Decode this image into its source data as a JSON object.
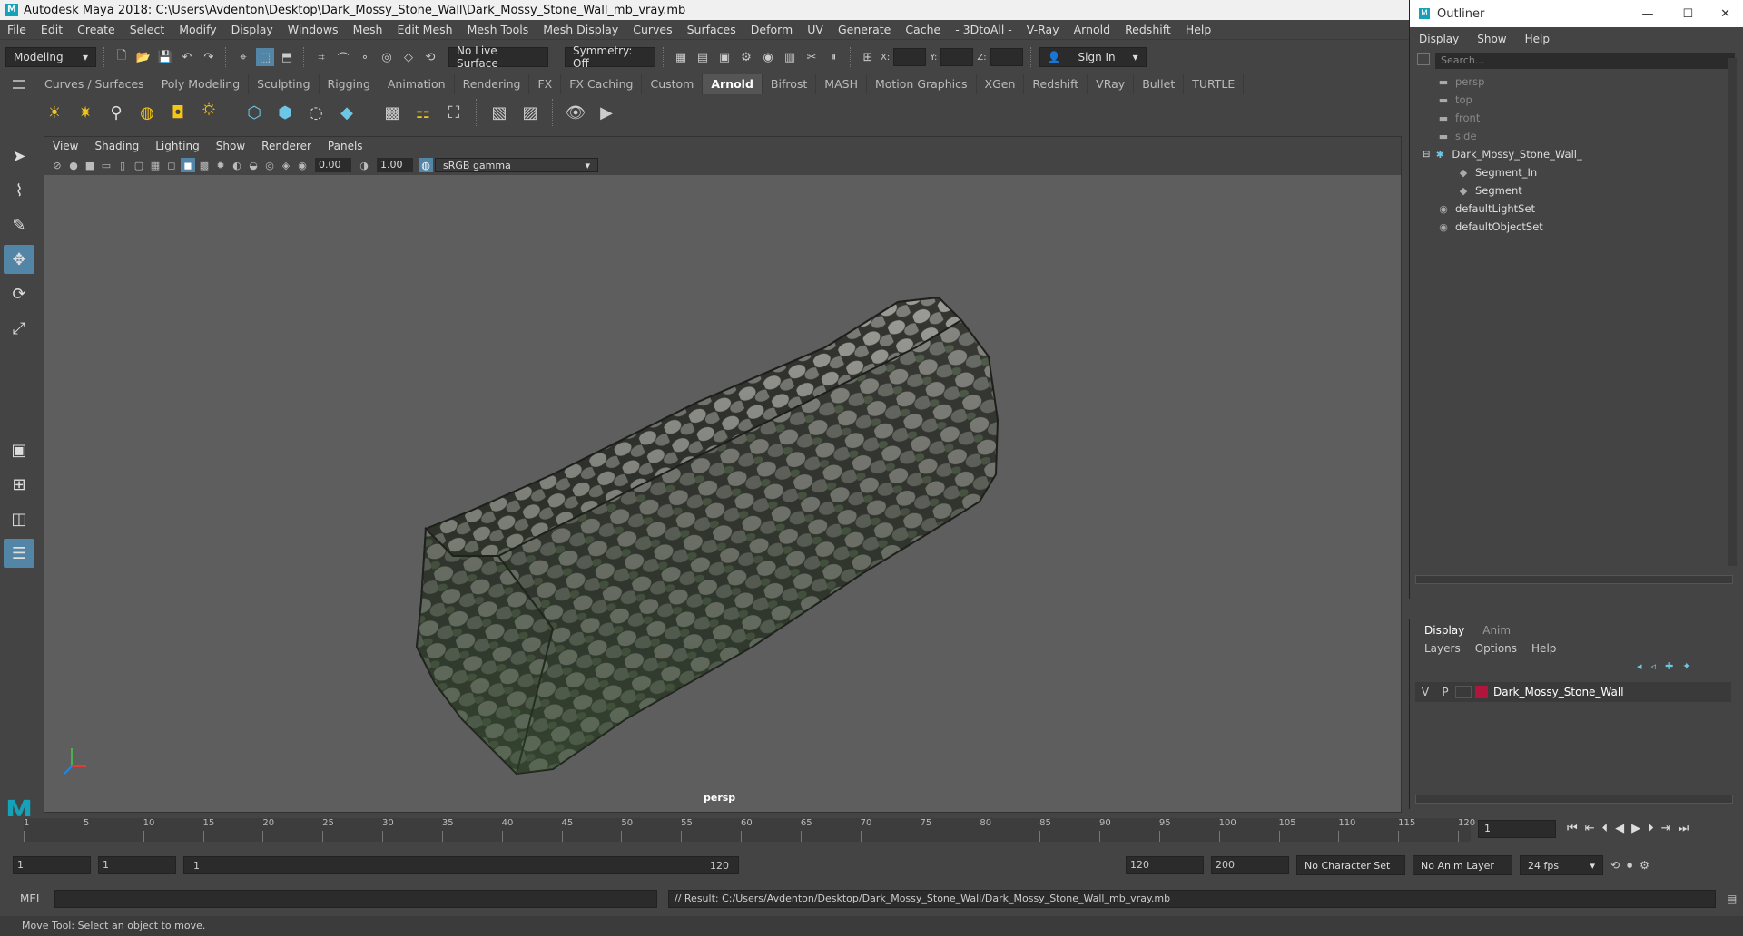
{
  "window": {
    "title": "Autodesk Maya 2018: C:\\Users\\Avdenton\\Desktop\\Dark_Mossy_Stone_Wall\\Dark_Mossy_Stone_Wall_mb_vray.mb"
  },
  "menubar": [
    "File",
    "Edit",
    "Create",
    "Select",
    "Modify",
    "Display",
    "Windows",
    "Mesh",
    "Edit Mesh",
    "Mesh Tools",
    "Mesh Display",
    "Curves",
    "Surfaces",
    "Deform",
    "UV",
    "Generate",
    "Cache",
    "- 3DtoAll -",
    "V-Ray",
    "Arnold",
    "Redshift",
    "Help"
  ],
  "statusline": {
    "mode": "Modeling",
    "live_surface": "No Live Surface",
    "symmetry": "Symmetry: Off",
    "x_label": "X:",
    "y_label": "Y:",
    "z_label": "Z:",
    "sign_in": "Sign In"
  },
  "shelf_tabs": [
    "Curves / Surfaces",
    "Poly Modeling",
    "Sculpting",
    "Rigging",
    "Animation",
    "Rendering",
    "FX",
    "FX Caching",
    "Custom",
    "Arnold",
    "Bifrost",
    "MASH",
    "Motion Graphics",
    "XGen",
    "Redshift",
    "VRay",
    "Bullet",
    "TURTLE"
  ],
  "active_shelf_tab": "Arnold",
  "viewport": {
    "menu": [
      "View",
      "Shading",
      "Lighting",
      "Show",
      "Renderer",
      "Panels"
    ],
    "exposure": "0.00",
    "gamma": "1.00",
    "color_space": "sRGB gamma",
    "camera": "persp"
  },
  "outliner": {
    "title": "Outliner",
    "menu": [
      "Display",
      "Show",
      "Help"
    ],
    "search_placeholder": "Search...",
    "items": [
      {
        "label": "persp",
        "type": "camera",
        "dim": true,
        "indent": 1
      },
      {
        "label": "top",
        "type": "camera",
        "dim": true,
        "indent": 1
      },
      {
        "label": "front",
        "type": "camera",
        "dim": true,
        "indent": 1
      },
      {
        "label": "side",
        "type": "camera",
        "dim": true,
        "indent": 1
      },
      {
        "label": "Dark_Mossy_Stone_Wall_",
        "type": "group",
        "dim": false,
        "indent": 1
      },
      {
        "label": "Segment_In",
        "type": "mesh",
        "dim": false,
        "indent": 2
      },
      {
        "label": "Segment",
        "type": "mesh",
        "dim": false,
        "indent": 2
      },
      {
        "label": "defaultLightSet",
        "type": "set",
        "dim": false,
        "indent": 1
      },
      {
        "label": "defaultObjectSet",
        "type": "set",
        "dim": false,
        "indent": 1
      }
    ]
  },
  "layers": {
    "tabs": [
      "Display",
      "Anim"
    ],
    "menu": [
      "Layers",
      "Options",
      "Help"
    ],
    "row": {
      "v": "V",
      "p": "P",
      "name": "Dark_Mossy_Stone_Wall",
      "color": "#b0163c"
    }
  },
  "timeline": {
    "ticks": [
      "5",
      "10",
      "15",
      "20",
      "25",
      "30",
      "35",
      "40",
      "45",
      "50",
      "55",
      "60",
      "65",
      "70",
      "75",
      "80",
      "85",
      "90",
      "95",
      "100",
      "105",
      "110",
      "115",
      "120"
    ],
    "start_marker": "1",
    "current_frame": "1"
  },
  "range": {
    "start": "1",
    "anim_start": "1",
    "slider_start": "1",
    "slider_end": "120",
    "anim_end": "120",
    "end": "200",
    "character_set": "No Character Set",
    "anim_layer": "No Anim Layer",
    "fps": "24 fps"
  },
  "command": {
    "lang": "MEL",
    "result": "// Result: C:/Users/Avdenton/Desktop/Dark_Mossy_Stone_Wall/Dark_Mossy_Stone_Wall_mb_vray.mb"
  },
  "helpline": "Move Tool: Select an object to move."
}
